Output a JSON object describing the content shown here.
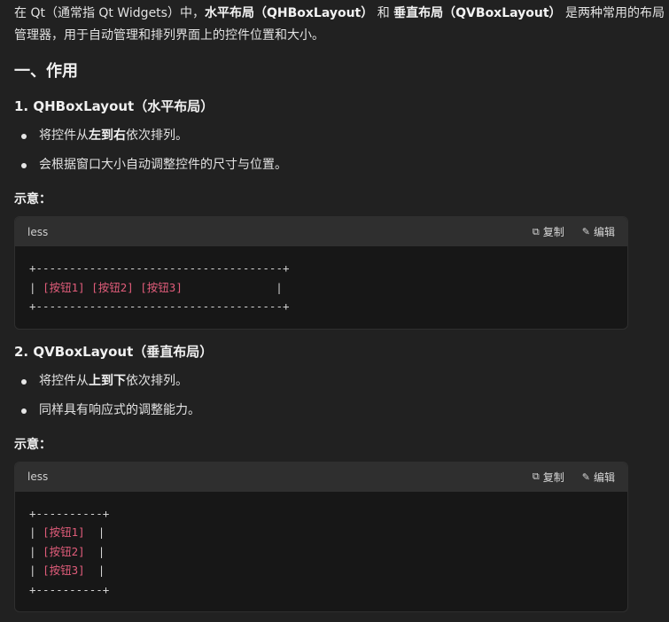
{
  "intro": {
    "t1": "在 Qt（通常指 Qt Widgets）中，",
    "b1": "水平布局（QHBoxLayout）",
    "t2": " 和 ",
    "b2": "垂直布局（QVBoxLayout）",
    "t3": " 是两种常用的布局管理器，用于自动管理和排列界面上的控件位置和大小。"
  },
  "section_title": "一、作用",
  "hbox": {
    "title": "1. QHBoxLayout（水平布局）",
    "bullet1": {
      "pre": "将控件从",
      "bold": "左到右",
      "post": "依次排列。"
    },
    "bullet2": "会根据窗口大小自动调整控件的尺寸与位置。",
    "label": "示意：",
    "code": {
      "lang": "less",
      "copy": "复制",
      "edit": "编辑",
      "line1": "+-------------------------------------+",
      "line2_pre": "| ",
      "line2_pink": "[按钮1] [按钮2] [按钮3]",
      "line2_post": "              |",
      "line3": "+-------------------------------------+"
    }
  },
  "vbox": {
    "title": "2. QVBoxLayout（垂直布局）",
    "bullet1": {
      "pre": "将控件从",
      "bold": "上到下",
      "post": "依次排列。"
    },
    "bullet2": "同样具有响应式的调整能力。",
    "label": "示意：",
    "code": {
      "lang": "less",
      "copy": "复制",
      "edit": "编辑",
      "border": "+----------+",
      "bar": "| ",
      "bar_end": "  |",
      "btn1": "[按钮1]",
      "btn2": "[按钮2]",
      "btn3": "[按钮3]"
    }
  }
}
